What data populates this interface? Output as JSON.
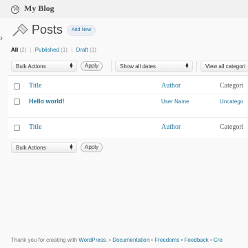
{
  "header": {
    "blog_title": "My Blog"
  },
  "page": {
    "title": "Posts",
    "add_new": "Add New"
  },
  "filters": {
    "all": "All",
    "all_count": "(2)",
    "published": "Published",
    "published_count": "(1)",
    "draft": "Draft",
    "draft_count": "(1)",
    "separator": "|"
  },
  "toolbar_top": {
    "bulk_actions": "Bulk Actions",
    "apply": "Apply",
    "show_all_dates": "Show all dates",
    "view_all_categories": "View all categori"
  },
  "table": {
    "columns": {
      "title": "Title",
      "author": "Author",
      "categories": "Categori"
    },
    "rows": [
      {
        "title": "Hello world!",
        "author": "User Name",
        "categories": "Uncatego"
      }
    ]
  },
  "toolbar_bottom": {
    "bulk_actions": "Bulk Actions",
    "apply": "Apply"
  },
  "footer": {
    "thanks_prefix": "Thank you for creating with ",
    "wordpress": "WordPress",
    "links": [
      "Documentation",
      "Freedoms",
      "Feedback",
      "Cre"
    ],
    "bullet": "•"
  },
  "colors": {
    "link": "#21759b",
    "header_bg": "#f1f1f1",
    "page_bg": "#f9f9f9"
  },
  "icons": {
    "wp_logo": "wordpress-logo-icon",
    "posts": "pushpin-icon",
    "menu_collapse": "chevron-right-icon"
  }
}
